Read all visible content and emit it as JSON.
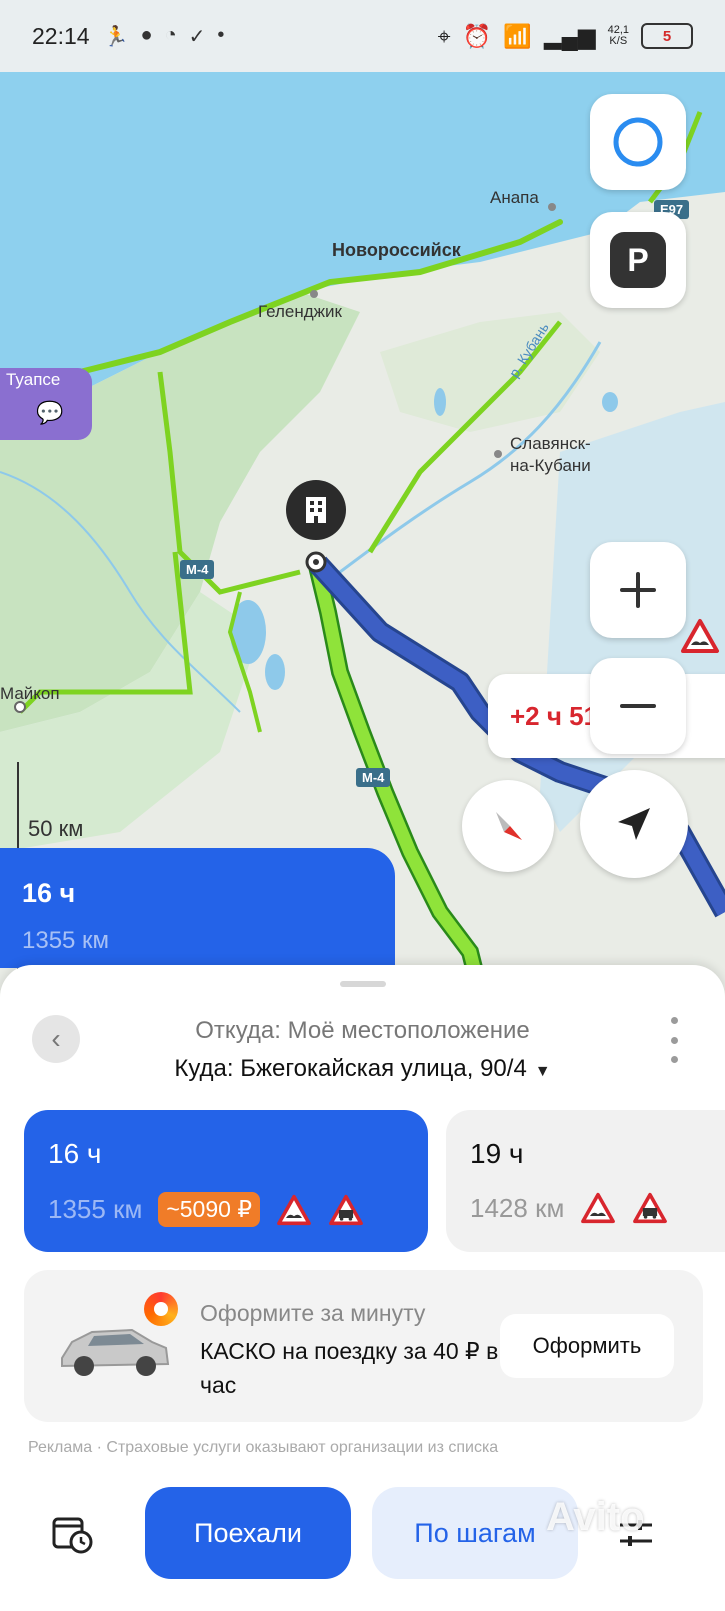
{
  "status_bar": {
    "time": "22:14",
    "net_speed_value": "42,1",
    "net_speed_unit": "K/S",
    "battery": "5"
  },
  "map": {
    "labels": {
      "anapa": "Анапа",
      "novorossiysk": "Новороссийск",
      "gelendzhik": "Геленджик",
      "tuapse": "Туапсе",
      "slavyansk": "Славянск-",
      "slavyansk2": "на-Кубани",
      "kuban": "р. Кубань",
      "maykop": "Майкоп",
      "m4_a": "М-4",
      "m4_b": "М-4",
      "e97": "Е97"
    },
    "delay": "+2 ч 51 мин",
    "scale": "50 км",
    "peek_time": "16 ч",
    "peek_dist": "1355 км"
  },
  "route": {
    "from": "Откуда: Моё местоположение",
    "to": "Куда: Бжегокайская улица, 90/4"
  },
  "routes": [
    {
      "time": "16 ч",
      "distance": "1355 км",
      "toll": "~5090 ₽"
    },
    {
      "time": "19 ч",
      "distance": "1428 км"
    }
  ],
  "ad": {
    "subtitle": "Оформите за минуту",
    "title": "КАСКО на поездку за 40 ₽ в час",
    "cta": "Оформить",
    "disclaimer": "Реклама · Страховые услуги оказывают организации из списка"
  },
  "actions": {
    "go": "Поехали",
    "steps": "По шагам"
  },
  "watermark": "Avito",
  "colors": {
    "primary": "#2463e8",
    "route_green": "#7ed321",
    "route_blue": "#3d5fc4",
    "toll_orange": "#f07c28",
    "delay_red": "#d8262e"
  }
}
